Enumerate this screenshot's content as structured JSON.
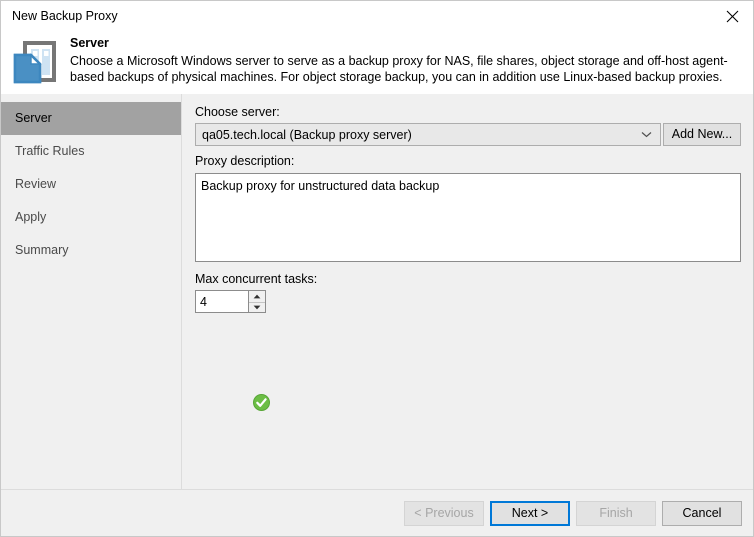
{
  "window": {
    "title": "New Backup Proxy",
    "close_icon": "close-icon"
  },
  "header": {
    "icon": "server-document-icon",
    "title": "Server",
    "description": "Choose a Microsoft Windows server to serve as a backup proxy for NAS, file shares, object storage and off-host agent-based backups of physical machines. For object storage backup, you can in addition use Linux-based backup proxies."
  },
  "sidebar": {
    "items": [
      {
        "label": "Server",
        "selected": true
      },
      {
        "label": "Traffic Rules",
        "selected": false
      },
      {
        "label": "Review",
        "selected": false
      },
      {
        "label": "Apply",
        "selected": false
      },
      {
        "label": "Summary",
        "selected": false
      }
    ]
  },
  "main": {
    "choose_server_label": "Choose server:",
    "server_combo": {
      "value": "qa05.tech.local (Backup proxy server)",
      "arrow_icon": "chevron-down-icon"
    },
    "add_new_label": "Add New...",
    "proxy_description_label": "Proxy description:",
    "proxy_description_value": "Backup proxy for unstructured data backup",
    "max_concurrent_tasks_label": "Max concurrent tasks:",
    "max_concurrent_tasks_value": "4",
    "spinner_up_icon": "spinner-up-arrow-icon",
    "spinner_down_icon": "spinner-down-arrow-icon",
    "status_icon": "green-check-circle-icon"
  },
  "footer": {
    "previous_label": "< Previous",
    "next_label": "Next >",
    "finish_label": "Finish",
    "cancel_label": "Cancel"
  },
  "colors": {
    "accent_blue": "#0078d7",
    "icon_blue": "#4a90c4",
    "icon_gray": "#767676",
    "success_green": "#6cbe45",
    "selected_gray": "#a2a2a2",
    "panel_gray": "#f0f0f0"
  }
}
